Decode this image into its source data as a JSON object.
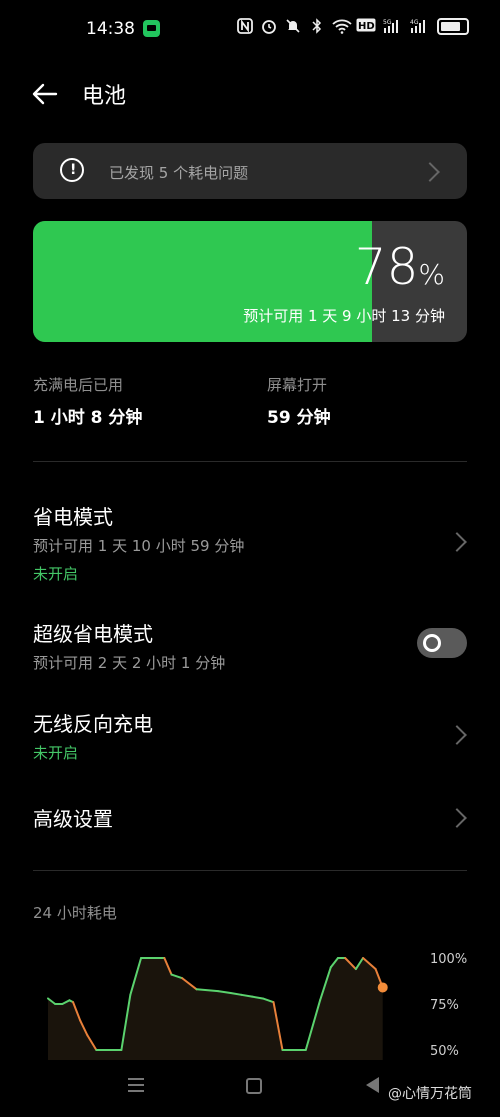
{
  "status_bar": {
    "time": "14:38",
    "icons": [
      "message-icon",
      "nfc-icon",
      "alarm-icon",
      "mute-icon",
      "bluetooth-icon",
      "wifi-icon",
      "hd-icon",
      "signal-5g-icon",
      "signal-4g-icon",
      "battery-icon"
    ],
    "hd_label": "HD",
    "net_a": "5G",
    "net_b": "4G"
  },
  "header": {
    "title": "电池"
  },
  "issue_banner": {
    "text": "已发现 5 个耗电问题"
  },
  "battery": {
    "level_percent": 78,
    "percent_number": "78",
    "percent_sign": "%",
    "estimate": "预计可用 1 天 9 小时 13 分钟",
    "fill_color": "#2fc851"
  },
  "stats": {
    "since_full_label": "充满电后已用",
    "since_full_value": "1 小时 8 分钟",
    "screen_on_label": "屏幕打开",
    "screen_on_value": "59 分钟"
  },
  "settings": {
    "power_saving": {
      "title": "省电模式",
      "subtitle": "预计可用 1 天 10 小时 59 分钟",
      "status": "未开启"
    },
    "super_power_saving": {
      "title": "超级省电模式",
      "subtitle": "预计可用 2 天 2 小时 1 分钟",
      "enabled": false
    },
    "wireless_reverse": {
      "title": "无线反向充电",
      "status": "未开启"
    },
    "advanced": {
      "title": "高级设置"
    }
  },
  "chart_section": {
    "title": "24 小时耗电"
  },
  "chart_data": {
    "type": "line",
    "title": "24 小时耗电",
    "y_tick_labels": [
      "100%",
      "75%",
      "50%"
    ],
    "ylim": [
      50,
      100
    ],
    "series": [
      {
        "values": [
          [
            0,
            78
          ],
          [
            0.4,
            75
          ],
          [
            0.8,
            75
          ],
          [
            1.2,
            77
          ],
          [
            1.4,
            76
          ],
          [
            1.8,
            66
          ],
          [
            2.2,
            58
          ],
          [
            2.7,
            50
          ],
          [
            4.1,
            50
          ],
          [
            4.6,
            80
          ],
          [
            5.2,
            100
          ],
          [
            6.5,
            100
          ],
          [
            6.9,
            91
          ],
          [
            7.5,
            89
          ],
          [
            8.3,
            83
          ],
          [
            9.5,
            82
          ],
          [
            10.2,
            81
          ],
          [
            10.8,
            80
          ],
          [
            11.4,
            79
          ],
          [
            12.0,
            78
          ],
          [
            12.6,
            76
          ],
          [
            13.1,
            50
          ],
          [
            14.4,
            50
          ],
          [
            15.2,
            77
          ],
          [
            15.8,
            95
          ],
          [
            16.2,
            100
          ],
          [
            16.6,
            100
          ],
          [
            17.2,
            94
          ],
          [
            17.6,
            100
          ],
          [
            18.3,
            94
          ],
          [
            18.7,
            84
          ]
        ],
        "color": "#5bd26e"
      }
    ],
    "current_point": [
      18.7,
      84
    ],
    "current_color": "#f28c3a"
  },
  "navigation": {
    "icons": [
      "menu-icon",
      "home-icon",
      "back-icon"
    ]
  },
  "watermark": {
    "text": "@心情万花筒"
  }
}
